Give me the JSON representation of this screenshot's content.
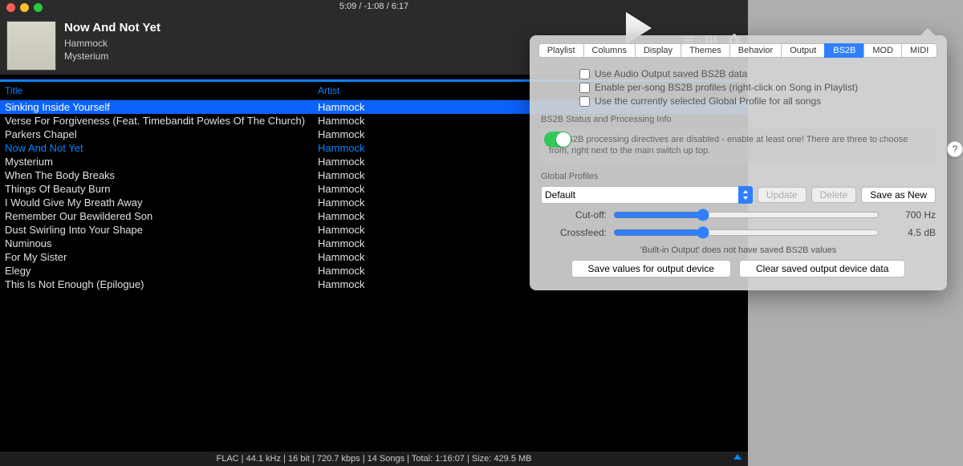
{
  "playback": {
    "elapsed": "5:09",
    "remaining": "-1:08",
    "total": "6:17",
    "time_display": "5:09 / -1:08 / 6:17"
  },
  "now_playing": {
    "title": "Now And Not Yet",
    "artist": "Hammock",
    "album": "Mysterium"
  },
  "columns": {
    "title": "Title",
    "artist": "Artist"
  },
  "playlist": [
    {
      "title": "Sinking Inside Yourself",
      "artist": "Hammock",
      "selected": true
    },
    {
      "title": "Verse For Forgiveness (Feat. Timebandit Powles Of The Church)",
      "artist": "Hammock"
    },
    {
      "title": "Parkers Chapel",
      "artist": "Hammock"
    },
    {
      "title": "Now And Not Yet",
      "artist": "Hammock",
      "playing": true
    },
    {
      "title": "Mysterium",
      "artist": "Hammock"
    },
    {
      "title": "When The Body Breaks",
      "artist": "Hammock"
    },
    {
      "title": "Things Of Beauty Burn",
      "artist": "Hammock"
    },
    {
      "title": "I Would Give My Breath Away",
      "artist": "Hammock"
    },
    {
      "title": "Remember Our Bewildered Son",
      "artist": "Hammock"
    },
    {
      "title": "Dust Swirling Into Your Shape",
      "artist": "Hammock"
    },
    {
      "title": "Numinous",
      "artist": "Hammock"
    },
    {
      "title": "For My Sister",
      "artist": "Hammock"
    },
    {
      "title": "Elegy",
      "artist": "Hammock"
    },
    {
      "title": "This Is Not Enough  (Epilogue)",
      "artist": "Hammock"
    }
  ],
  "statusbar": "FLAC | 44.1 kHz | 16 bit | 720.7 kbps | 14 Songs | Total: 1:16:07 | Size: 429.5 MB",
  "prefs": {
    "tabs": [
      "Playlist",
      "Columns",
      "Display",
      "Themes",
      "Behavior",
      "Output",
      "BS2B",
      "MOD",
      "MIDI"
    ],
    "active_tab": "BS2B",
    "checks": {
      "use_saved": "Use Audio Output saved BS2B data",
      "per_song": "Enable per-song BS2B profiles (right-click on Song in Playlist)",
      "global_all": "Use the currently selected Global Profile for all songs"
    },
    "status_label": "BS2B Status and Processing Info",
    "status_text": "All BS2B processing directives are disabled - enable at least one! There are three to choose from, right next to the main switch up top.",
    "global_profiles_label": "Global Profiles",
    "profile_selected": "Default",
    "buttons": {
      "update": "Update",
      "delete": "Delete",
      "save_new": "Save as New",
      "save_device": "Save values for output device",
      "clear_device": "Clear saved output device data"
    },
    "cutoff": {
      "label": "Cut-off:",
      "value": "700 Hz"
    },
    "crossfeed": {
      "label": "Crossfeed:",
      "value": "4.5 dB"
    },
    "note": "'Built-in Output' does not have saved BS2B values",
    "help": "?"
  }
}
